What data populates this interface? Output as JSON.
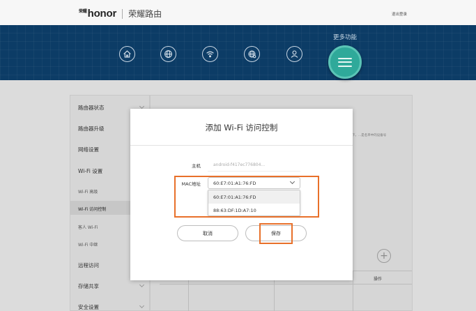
{
  "header": {
    "brand": "honor",
    "brand_small": "荣耀",
    "product": "荣耀路由",
    "logout": "退出登录"
  },
  "nav": {
    "icons": [
      "home-icon",
      "globe-icon",
      "wifi-icon",
      "network-icon",
      "user-icon"
    ],
    "more_label": "更多功能",
    "more_icon": "menu-icon"
  },
  "sidebar": {
    "items": [
      "路由器状态",
      "路由器升级",
      "网络设置",
      "Wi-Fi 设置"
    ],
    "wifi_subitems": [
      "Wi-Fi 高级",
      "Wi-Fi 访问控制",
      "客人 Wi-Fi",
      "Wi-Fi 中继"
    ],
    "items_after": [
      "远程访问",
      "存储共享",
      "安全设置"
    ]
  },
  "background": {
    "hint": "下，...是名单中的设备号",
    "table_op_header": "操作"
  },
  "modal": {
    "title": "添加 Wi-Fi 访问控制",
    "host_label": "主机",
    "host_placeholder": "android-f417ec776804...",
    "mac_label": "MAC地址",
    "mac_value": "60:E7:01:A1:76:FD",
    "mac_options": [
      "60:E7:01:A1:76:FD",
      "88:63:DF:1D:A7:10"
    ],
    "cancel_label": "取消",
    "save_label": "保存"
  },
  "colors": {
    "nav_bg": "#0c3c66",
    "accent_teal": "#2fa99a",
    "highlight": "#e8702a"
  }
}
